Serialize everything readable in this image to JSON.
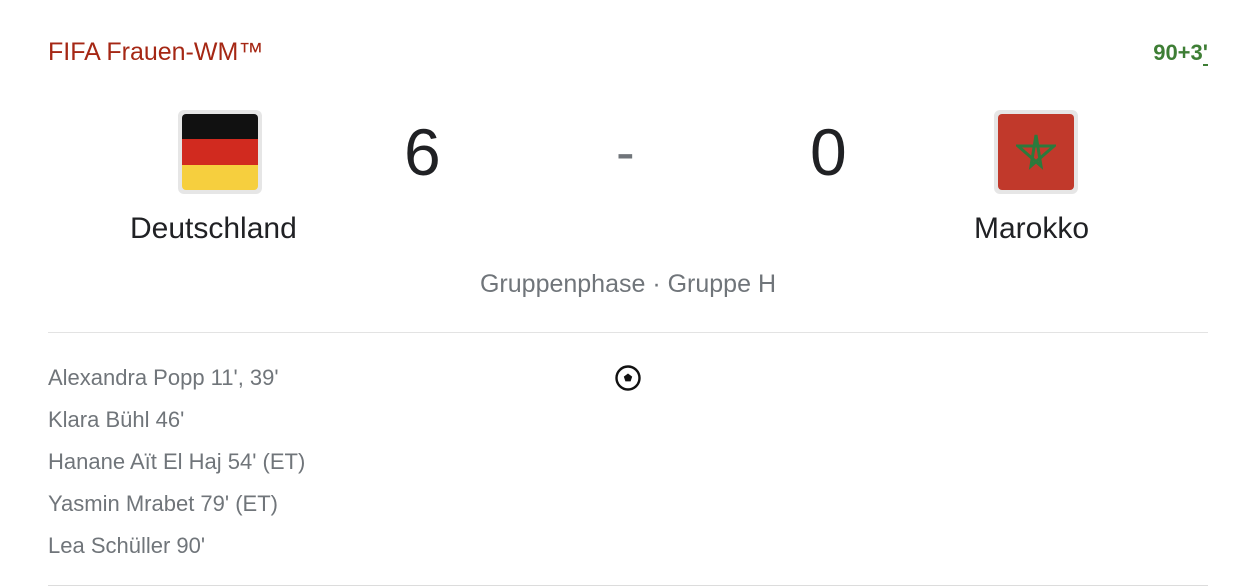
{
  "match": {
    "competition": "FIFA Frauen-WM™",
    "live_time": "90+3",
    "live_marker": "'",
    "home": {
      "name": "Deutschland",
      "score": "6",
      "flag_icon": "germany-flag-icon",
      "flag_colors": [
        "#111111",
        "#d12a1f",
        "#f6cf3e"
      ]
    },
    "away": {
      "name": "Marokko",
      "score": "0",
      "flag_icon": "morocco-flag-icon",
      "flag_colors": [
        "#c1392b",
        "#2c7a3c"
      ]
    },
    "separator": "-",
    "stage": "Gruppenphase · Gruppe H",
    "goal_icon": "soccer-ball-icon",
    "scorers": [
      "Alexandra Popp 11', 39'",
      "Klara Bühl 46'",
      "Hanane Aït El Haj 54' (ET)",
      "Yasmin Mrabet 79' (ET)",
      "Lea Schüller 90'"
    ]
  },
  "colors": {
    "competition": "#a52714",
    "live": "#3e7e35",
    "text_primary": "#202124",
    "text_secondary": "#70757a"
  }
}
